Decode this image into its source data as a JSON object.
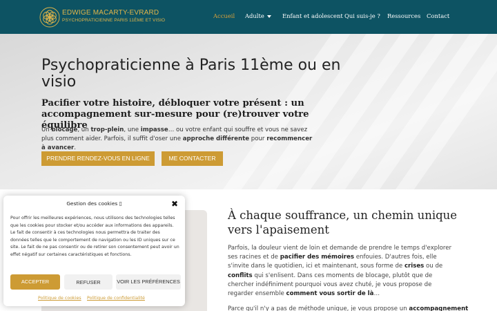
{
  "header": {
    "brand_name": "EDWIGE MACARTY-EVRARD",
    "brand_tagline": "PSYCHOPRATICIENNE PARIS 11ÈME ET VISIO",
    "nav": [
      {
        "label": "Accueil"
      },
      {
        "label": "Adulte"
      },
      {
        "label": "Enfant et adolescent"
      },
      {
        "label": "Qui suis-je ?"
      },
      {
        "label": "Ressources"
      },
      {
        "label": "Contact"
      }
    ],
    "colors": {
      "bar": "#0d5363",
      "accent": "#cd9b34"
    }
  },
  "hero": {
    "title": "Psychopraticienne à Paris 11ème ou en visio",
    "subtitle": "Pacifier votre histoire, débloquer votre présent : un accompagnement sur-mesure pour (re)trouver votre équilibre",
    "text": {
      "t1": "Un ",
      "b1": "blocage",
      "t2": ", un ",
      "b2": "trop-plein",
      "t3": ", une ",
      "b3": "impasse",
      "t4": "… ou votre enfant qui souffre et vous ne savez plus comment aider. Parfois, il suffit d'oser une ",
      "b4": "approche différente",
      "t5": " pour ",
      "b5": "recommencer à avancer",
      "t6": "."
    },
    "btn_rdv": "PRENDRE RENDEZ-VOUS EN LIGNE",
    "btn_contact": "ME CONTACTER"
  },
  "section": {
    "title": "À chaque souffrance, un chemin unique vers l'apaisement",
    "p1": {
      "t1": "Parfois, la douleur vient de loin et demande de prendre le temps d'explorer ses racines et de ",
      "b1": "pacifier des mémoires",
      "t2": " enfouies. D'autres fois, elle s'invite dans le quotidien, ici et maintenant, sous forme de ",
      "b2": "crises",
      "t3": " ou de ",
      "b3": "conflits",
      "t4": " qui s'enlisent. Dans ces moments de blocage, plutôt que de chercher indéfiniment pourquoi vous avez chuté, je vous propose de regarder ensemble ",
      "b4": "comment vous sortir de là",
      "t5": "…"
    },
    "p2": {
      "t1": "Parce qu'il n'y a pas de méthode unique, je vous propose un ",
      "b1": "accompagnement"
    }
  },
  "cookie": {
    "title": "Gestion des cookies",
    "info_glyph": "▯",
    "close_glyph": "✖",
    "text": "Pour offrir les meilleures expériences, nous utilisons des technologies telles que les cookies pour stocker et/ou accéder aux informations des appareils. Le fait de consentir à ces technologies nous permettra de traiter des données telles que le comportement de navigation ou les ID uniques sur ce site. Le fait de ne pas consentir ou de retirer son consentement peut avoir un effet négatif sur certaines caractéristiques et fonctions.",
    "accept": "ACCEPTER",
    "refuse": "REFUSER",
    "prefs": "VOIR LES PRÉFÉRENCES",
    "link_cookies": "Politique de cookies",
    "link_privacy": "Politique de confidentialité"
  }
}
